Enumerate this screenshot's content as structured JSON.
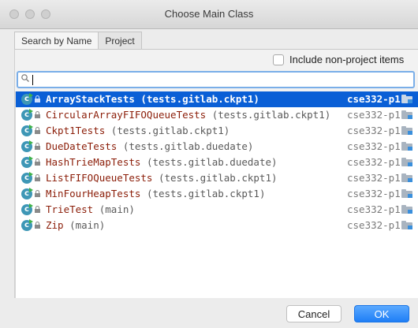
{
  "window": {
    "title": "Choose Main Class"
  },
  "tabs": [
    {
      "label": "Search by Name",
      "active": true
    },
    {
      "label": "Project",
      "active": false
    }
  ],
  "include_non_project": {
    "label": "Include non-project items",
    "checked": false
  },
  "search": {
    "value": ""
  },
  "results": [
    {
      "name": "ArrayStackTests",
      "pkg": "(tests.gitlab.ckpt1)",
      "module": "cse332-p1",
      "selected": true
    },
    {
      "name": "CircularArrayFIFOQueueTests",
      "pkg": "(tests.gitlab.ckpt1)",
      "module": "cse332-p1",
      "selected": false
    },
    {
      "name": "Ckpt1Tests",
      "pkg": "(tests.gitlab.ckpt1)",
      "module": "cse332-p1",
      "selected": false
    },
    {
      "name": "DueDateTests",
      "pkg": "(tests.gitlab.duedate)",
      "module": "cse332-p1",
      "selected": false
    },
    {
      "name": "HashTrieMapTests",
      "pkg": "(tests.gitlab.duedate)",
      "module": "cse332-p1",
      "selected": false
    },
    {
      "name": "ListFIFOQueueTests",
      "pkg": "(tests.gitlab.ckpt1)",
      "module": "cse332-p1",
      "selected": false
    },
    {
      "name": "MinFourHeapTests",
      "pkg": "(tests.gitlab.ckpt1)",
      "module": "cse332-p1",
      "selected": false
    },
    {
      "name": "TrieTest",
      "pkg": "(main)",
      "module": "cse332-p1",
      "selected": false
    },
    {
      "name": "Zip",
      "pkg": "(main)",
      "module": "cse332-p1",
      "selected": false
    }
  ],
  "buttons": {
    "cancel": "Cancel",
    "ok": "OK"
  },
  "icons": {
    "class": "class-icon",
    "lock": "lock-icon",
    "module": "module-folder-icon",
    "search": "search-icon"
  },
  "colors": {
    "selection": "#0a5fd6",
    "accent": "#1f7ef6",
    "class_name": "#8b1d08"
  }
}
